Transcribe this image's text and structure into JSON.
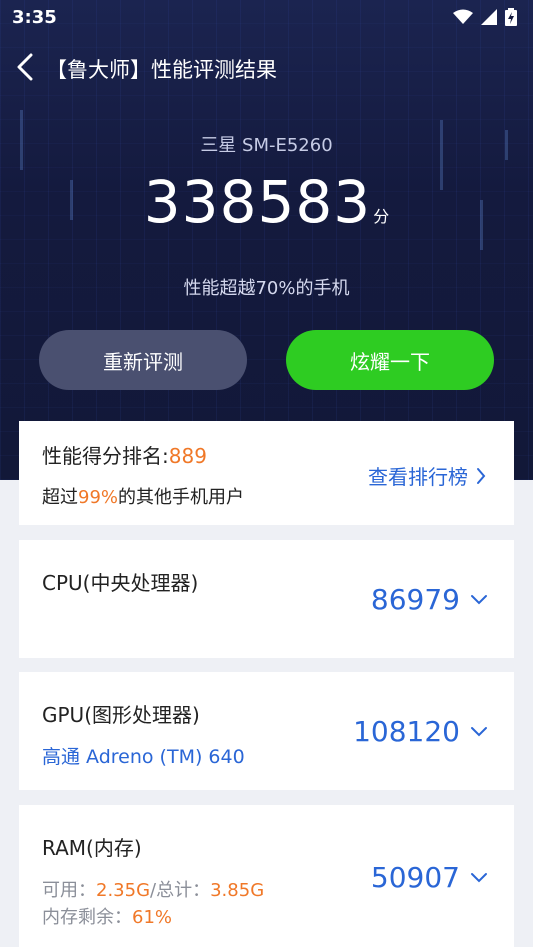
{
  "status_bar": {
    "time": "3:35"
  },
  "header": {
    "title": "【鲁大师】性能评测结果"
  },
  "hero": {
    "device": "三星 SM-E5260",
    "score": "338583",
    "score_unit": "分",
    "beat_text": "性能超越70%的手机"
  },
  "buttons": {
    "retest": "重新评测",
    "share": "炫耀一下"
  },
  "rank": {
    "label": "性能得分排名:",
    "value": "889",
    "exceed_prefix": "超过",
    "exceed_percent": "99%",
    "exceed_suffix": "的其他手机用户",
    "link": "查看排行榜"
  },
  "metrics": {
    "cpu": {
      "label": "CPU(中央处理器)",
      "score": "86979"
    },
    "gpu": {
      "label": "GPU(图形处理器)",
      "detail": "高通 Adreno (TM) 640",
      "score": "108120"
    },
    "ram": {
      "label": "RAM(内存)",
      "available_label": "可用：",
      "available": "2.35G",
      "total_label": "/总计：",
      "total": "3.85G",
      "remain_label": "内存剩余：",
      "remain": "61%",
      "score": "50907"
    }
  },
  "colors": {
    "accent": "#2a66d6",
    "highlight": "#f07828",
    "share_button": "#2ecc22",
    "hero_bg": "#141a3e"
  }
}
